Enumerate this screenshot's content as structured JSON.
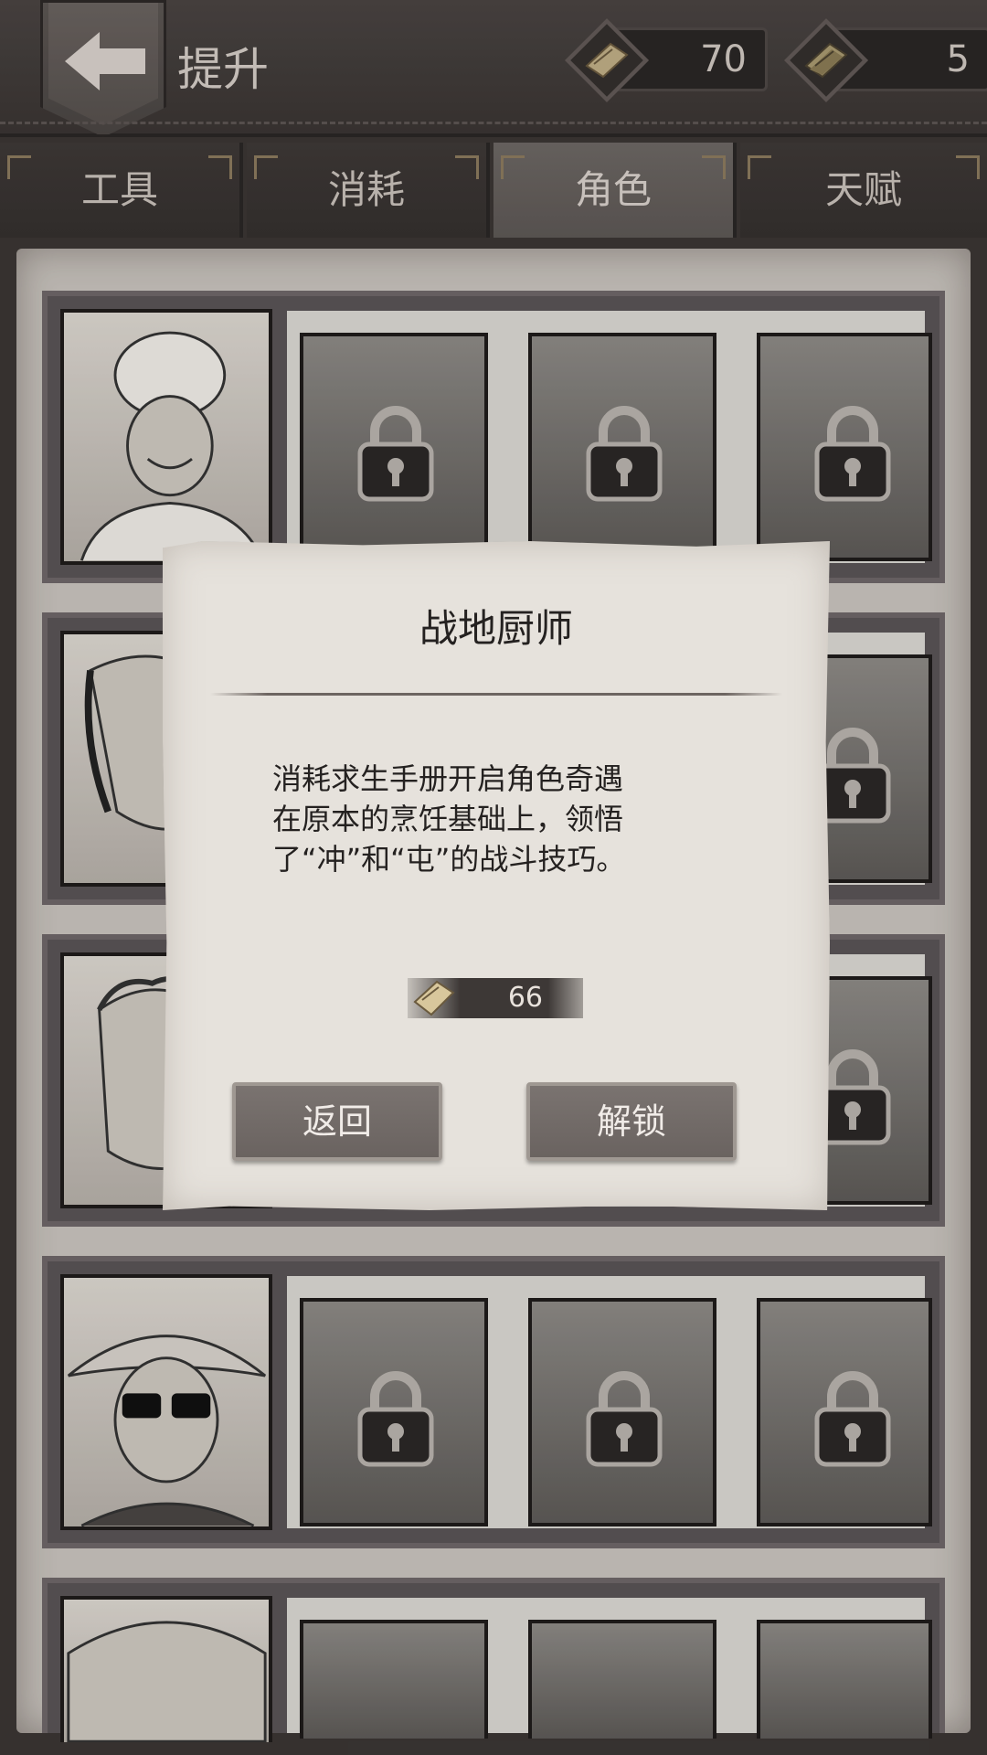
{
  "header": {
    "title": "提升",
    "currencies": [
      {
        "icon": "manual-book-icon",
        "value": "70"
      },
      {
        "icon": "premium-book-icon",
        "value": "5"
      }
    ]
  },
  "tabs": [
    {
      "label": "工具",
      "active": false
    },
    {
      "label": "消耗",
      "active": false
    },
    {
      "label": "角色",
      "active": true
    },
    {
      "label": "天赋",
      "active": false
    }
  ],
  "character_rows": [
    {
      "main": "chef-portrait",
      "locked": [
        "locked-character",
        "locked-character",
        "locked-character"
      ]
    },
    {
      "main": "scarred-woman-portrait",
      "locked": [
        "locked-character"
      ]
    },
    {
      "main": "curly-man-portrait",
      "locked": [
        "locked-character"
      ]
    },
    {
      "main": "sunglasses-hat-portrait",
      "locked": [
        "locked-character",
        "locked-character",
        "locked-character"
      ]
    },
    {
      "main": "hat-portrait",
      "locked": []
    }
  ],
  "modal": {
    "title": "战地厨师",
    "description_lines": [
      "消耗求生手册开启角色奇遇",
      "在原本的烹饪基础上，领悟",
      "了“冲”和“屯”的战斗技巧。"
    ],
    "cost": "66",
    "back_label": "返回",
    "unlock_label": "解锁"
  },
  "colors": {
    "paper": "#c9c4be",
    "dialog": "#e6e2dc",
    "button": "#6a6360",
    "header": "#3b3634"
  }
}
